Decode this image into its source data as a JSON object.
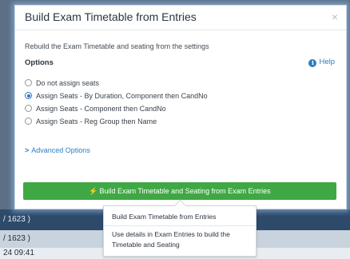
{
  "background": {
    "row1": "/ 1623 )",
    "row2": "/ 1623 )",
    "row3": "24 09:41"
  },
  "modal": {
    "title": "Build Exam Timetable from Entries",
    "close_glyph": "×",
    "description": "Rebuild the Exam Timetable and seating from the settings",
    "options_label": "Options",
    "help_label": "Help",
    "radio_options": [
      {
        "label": "Do not assign seats",
        "checked": false
      },
      {
        "label": "Assign Seats - By Duration, Component then CandNo",
        "checked": true
      },
      {
        "label": "Assign Seats - Component then CandNo",
        "checked": false
      },
      {
        "label": "Assign Seats - Reg Group then Name",
        "checked": false
      }
    ],
    "advanced_label": "Advanced Options",
    "build_button_label": "Build Exam Timetable and Seating from Exam Entries",
    "accent_color": "#3fa844",
    "link_color": "#2d7dc0"
  },
  "tooltip": {
    "title": "Build Exam Timetable from Entries",
    "body": "Use details in Exam Entries to build the Timetable and Seating"
  },
  "icons": {
    "help": "info-circle-icon",
    "advanced": "chevron-right-icon",
    "button": "bolt-icon"
  }
}
